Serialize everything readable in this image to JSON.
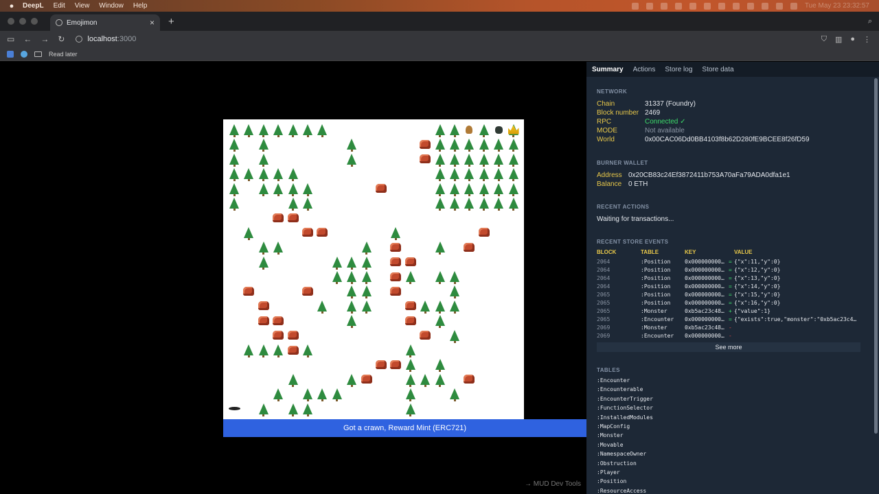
{
  "menubar": {
    "app_name": "DeepL",
    "menus": [
      "Edit",
      "View",
      "Window",
      "Help"
    ],
    "clock": "Tue May 23  23:32:57"
  },
  "browser": {
    "tab_title": "Emojimon",
    "new_tab": "+",
    "close_tab": "×",
    "url_host": "localhost",
    "url_port": ":3000",
    "bookmark_folder": "Read later"
  },
  "game": {
    "reward_banner": "Got a crawn, Reward Mint (ERC721)",
    "devtools_link": "→ MUD Dev Tools",
    "trees": [
      [
        0,
        0
      ],
      [
        1,
        0
      ],
      [
        2,
        0
      ],
      [
        3,
        0
      ],
      [
        4,
        0
      ],
      [
        5,
        0
      ],
      [
        6,
        0
      ],
      [
        14,
        0
      ],
      [
        15,
        0
      ],
      [
        17,
        0
      ],
      [
        19,
        0
      ],
      [
        0,
        1
      ],
      [
        2,
        1
      ],
      [
        8,
        1
      ],
      [
        14,
        1
      ],
      [
        15,
        1
      ],
      [
        16,
        1
      ],
      [
        17,
        1
      ],
      [
        18,
        1
      ],
      [
        19,
        1
      ],
      [
        0,
        2
      ],
      [
        2,
        2
      ],
      [
        8,
        2
      ],
      [
        14,
        2
      ],
      [
        15,
        2
      ],
      [
        16,
        2
      ],
      [
        17,
        2
      ],
      [
        18,
        2
      ],
      [
        19,
        2
      ],
      [
        0,
        3
      ],
      [
        1,
        3
      ],
      [
        2,
        3
      ],
      [
        3,
        3
      ],
      [
        4,
        3
      ],
      [
        14,
        3
      ],
      [
        15,
        3
      ],
      [
        16,
        3
      ],
      [
        17,
        3
      ],
      [
        18,
        3
      ],
      [
        19,
        3
      ],
      [
        0,
        4
      ],
      [
        2,
        4
      ],
      [
        3,
        4
      ],
      [
        4,
        4
      ],
      [
        5,
        4
      ],
      [
        14,
        4
      ],
      [
        15,
        4
      ],
      [
        16,
        4
      ],
      [
        17,
        4
      ],
      [
        18,
        4
      ],
      [
        19,
        4
      ],
      [
        0,
        5
      ],
      [
        4,
        5
      ],
      [
        5,
        5
      ],
      [
        14,
        5
      ],
      [
        15,
        5
      ],
      [
        16,
        5
      ],
      [
        17,
        5
      ],
      [
        18,
        5
      ],
      [
        19,
        5
      ],
      [
        1,
        7
      ],
      [
        11,
        7
      ],
      [
        2,
        8
      ],
      [
        3,
        8
      ],
      [
        9,
        8
      ],
      [
        14,
        8
      ],
      [
        2,
        9
      ],
      [
        7,
        9
      ],
      [
        8,
        9
      ],
      [
        9,
        9
      ],
      [
        7,
        10
      ],
      [
        8,
        10
      ],
      [
        9,
        10
      ],
      [
        12,
        10
      ],
      [
        14,
        10
      ],
      [
        15,
        10
      ],
      [
        8,
        11
      ],
      [
        9,
        11
      ],
      [
        15,
        11
      ],
      [
        6,
        12
      ],
      [
        8,
        12
      ],
      [
        9,
        12
      ],
      [
        13,
        12
      ],
      [
        14,
        12
      ],
      [
        15,
        12
      ],
      [
        8,
        13
      ],
      [
        14,
        13
      ],
      [
        15,
        14
      ],
      [
        1,
        15
      ],
      [
        2,
        15
      ],
      [
        3,
        15
      ],
      [
        5,
        15
      ],
      [
        12,
        15
      ],
      [
        12,
        16
      ],
      [
        14,
        16
      ],
      [
        4,
        17
      ],
      [
        8,
        17
      ],
      [
        12,
        17
      ],
      [
        13,
        17
      ],
      [
        14,
        17
      ],
      [
        3,
        18
      ],
      [
        5,
        18
      ],
      [
        6,
        18
      ],
      [
        7,
        18
      ],
      [
        12,
        18
      ],
      [
        15,
        18
      ],
      [
        2,
        19
      ],
      [
        4,
        19
      ],
      [
        5,
        19
      ],
      [
        12,
        19
      ]
    ],
    "rocks": [
      [
        13,
        1
      ],
      [
        13,
        2
      ],
      [
        10,
        4
      ],
      [
        3,
        6
      ],
      [
        4,
        6
      ],
      [
        5,
        7
      ],
      [
        6,
        7
      ],
      [
        17,
        7
      ],
      [
        11,
        8
      ],
      [
        16,
        8
      ],
      [
        11,
        9
      ],
      [
        12,
        9
      ],
      [
        11,
        10
      ],
      [
        1,
        11
      ],
      [
        5,
        11
      ],
      [
        11,
        11
      ],
      [
        2,
        12
      ],
      [
        12,
        12
      ],
      [
        2,
        13
      ],
      [
        3,
        13
      ],
      [
        12,
        13
      ],
      [
        3,
        14
      ],
      [
        4,
        14
      ],
      [
        13,
        14
      ],
      [
        4,
        15
      ],
      [
        10,
        16
      ],
      [
        11,
        16
      ],
      [
        9,
        17
      ],
      [
        16,
        17
      ]
    ],
    "crown_cell": [
      19,
      0
    ],
    "sprite_brown_cell": [
      16,
      0
    ],
    "sprite_dark_cell": [
      18,
      0
    ],
    "player_cell": [
      0,
      19
    ]
  },
  "devtools": {
    "tabs": [
      "Summary",
      "Actions",
      "Store log",
      "Store data"
    ],
    "network": {
      "heading": "NETWORK",
      "rows": [
        {
          "k": "Chain",
          "v": "31337 (Foundry)"
        },
        {
          "k": "Block number",
          "v": "2469"
        },
        {
          "k": "RPC",
          "v": "Connected ✓"
        },
        {
          "k": "MODE",
          "v": "Not available"
        },
        {
          "k": "World",
          "v": "0x00CAC06Dd0BB4103f8b62D280fE9BCEE8f26fD59"
        }
      ]
    },
    "wallet": {
      "heading": "BURNER WALLET",
      "rows": [
        {
          "k": "Address",
          "v": "0x20CB83c24Ef3872411b753A70aFa79ADA0dfa1e1"
        },
        {
          "k": "Balance",
          "v": "0 ETH"
        }
      ]
    },
    "recent_actions": {
      "heading": "RECENT ACTIONS",
      "text": "Waiting for transactions..."
    },
    "events": {
      "heading": "RECENT STORE EVENTS",
      "columns": [
        "BLOCK",
        "TABLE",
        "KEY",
        "VALUE"
      ],
      "rows": [
        {
          "block": "2064",
          "table": ":Position",
          "key": "0x000000000…",
          "sign": "=",
          "value": "{\"x\":11,\"y\":0}"
        },
        {
          "block": "2064",
          "table": ":Position",
          "key": "0x000000000…",
          "sign": "=",
          "value": "{\"x\":12,\"y\":0}"
        },
        {
          "block": "2064",
          "table": ":Position",
          "key": "0x000000000…",
          "sign": "=",
          "value": "{\"x\":13,\"y\":0}"
        },
        {
          "block": "2064",
          "table": ":Position",
          "key": "0x000000000…",
          "sign": "=",
          "value": "{\"x\":14,\"y\":0}"
        },
        {
          "block": "2065",
          "table": ":Position",
          "key": "0x000000000…",
          "sign": "=",
          "value": "{\"x\":15,\"y\":0}"
        },
        {
          "block": "2065",
          "table": ":Position",
          "key": "0x000000000…",
          "sign": "=",
          "value": "{\"x\":16,\"y\":0}"
        },
        {
          "block": "2065",
          "table": ":Monster",
          "key": "0xb5ac23c48…",
          "sign": "+",
          "value": "{\"value\":1}"
        },
        {
          "block": "2065",
          "table": ":Encounter",
          "key": "0x000000000…",
          "sign": "=",
          "value": "{\"exists\":true,\"monster\":\"0xb5ac23c4…"
        },
        {
          "block": "2069",
          "table": ":Monster",
          "key": "0xb5ac23c48…",
          "sign": "-",
          "value": ""
        },
        {
          "block": "2069",
          "table": ":Encounter",
          "key": "0x000000000…",
          "sign": "-",
          "value": ""
        }
      ],
      "see_more": "See more"
    },
    "tables": {
      "heading": "TABLES",
      "items": [
        ":Encounter",
        ":Encounterable",
        ":EncounterTrigger",
        ":FunctionSelector",
        ":InstalledModules",
        ":MapConfig",
        ":Monster",
        ":Movable",
        ":NamespaceOwner",
        ":Obstruction",
        ":Player",
        ":Position",
        ":ResourceAccess"
      ]
    }
  }
}
